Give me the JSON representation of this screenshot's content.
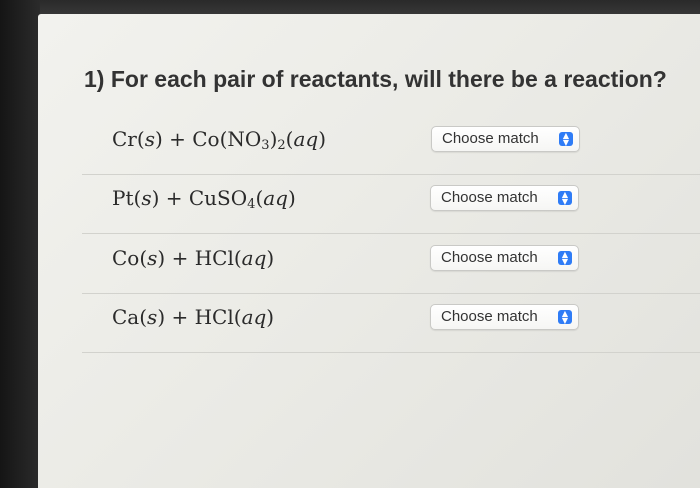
{
  "question": {
    "title": "1) For each pair of reactants, will there be a reaction?"
  },
  "rows": [
    {
      "reaction": {
        "metal": "Cr",
        "solid": "s",
        "plus": " + ",
        "compound_part1": "Co(NO",
        "sub1": "3",
        "compound_part2": ")",
        "sub2": "2",
        "aq": "aq"
      },
      "select": {
        "value": "Choose match"
      }
    },
    {
      "reaction": {
        "metal": "Pt",
        "solid": "s",
        "plus": " + ",
        "compound_part1": "CuSO",
        "sub1": "4",
        "aq": "aq"
      },
      "select": {
        "value": "Choose match"
      }
    },
    {
      "reaction": {
        "metal": "Co",
        "solid": "s",
        "plus": " + ",
        "compound": "HCl",
        "aq": "aq"
      },
      "select": {
        "value": "Choose match"
      }
    },
    {
      "reaction": {
        "metal": "Ca",
        "solid": "s",
        "plus": " + ",
        "compound": "HCl",
        "aq": "aq"
      },
      "select": {
        "value": "Choose match"
      }
    }
  ],
  "icons": {
    "select_chevron": "chevron-up-down-icon"
  },
  "colors": {
    "accent": "#2f7cf6",
    "text": "#333333",
    "background": "#efefea"
  }
}
